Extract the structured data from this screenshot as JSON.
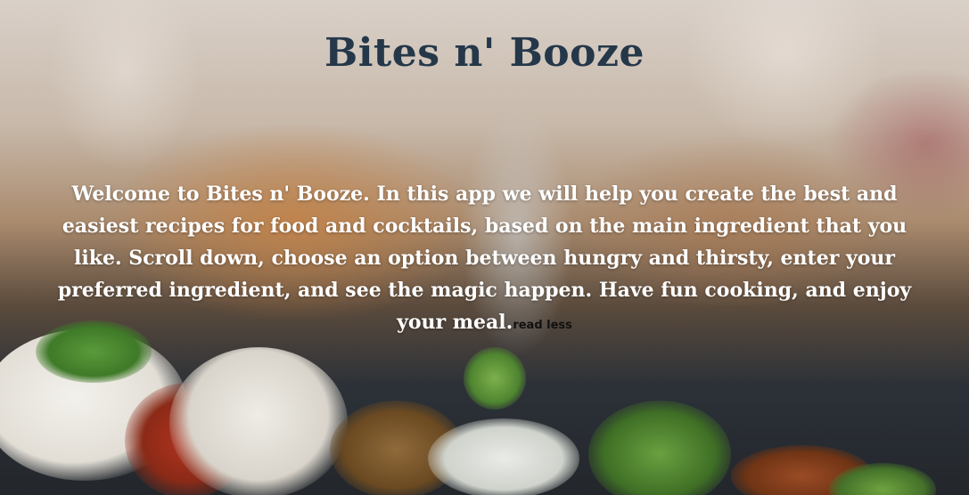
{
  "header": {
    "title": "Bites n' Booze"
  },
  "intro": {
    "text": "Welcome to Bites n' Booze. In this app we will help you create the best and easiest recipes for food and cocktails, based on the main ingredient that you like. Scroll down, choose an option between hungry and thirsty, enter your preferred ingredient, and see the magic happen. Have fun cooking, and enjoy your meal.",
    "toggle_label": "read less"
  },
  "colors": {
    "title": "#25384a",
    "intro_text": "#ffffff",
    "toggle_text": "#111111"
  }
}
